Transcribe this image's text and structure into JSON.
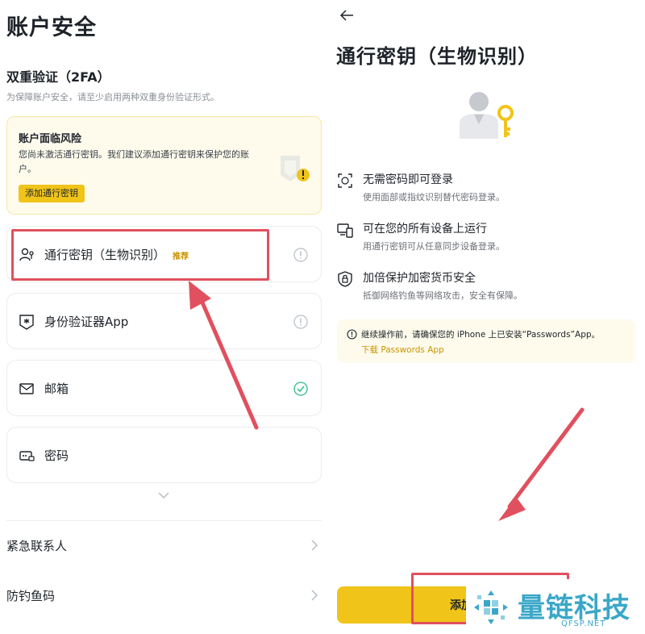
{
  "left": {
    "title": "账户安全",
    "twofa_title": "双重验证（2FA）",
    "twofa_sub": "为保障账户安全，请至少启用两种双重身份验证形式。",
    "risk": {
      "title": "账户面临风险",
      "text": "您尚未激活通行密钥。我们建议添加通行密钥来保护您的账户。",
      "button": "添加通行密钥"
    },
    "methods": [
      {
        "label": "通行密钥（生物识别）",
        "badge": "推荐",
        "icon": "passkey-icon",
        "status": "info"
      },
      {
        "label": "身份验证器App",
        "icon": "authenticator-icon",
        "status": "info"
      },
      {
        "label": "邮箱",
        "icon": "mail-icon",
        "status": "done"
      },
      {
        "label": "密码",
        "icon": "password-icon",
        "status": ""
      }
    ],
    "links": [
      {
        "label": "紧急联系人"
      },
      {
        "label": "防钓鱼码"
      }
    ]
  },
  "right": {
    "title": "通行密钥（生物识别）",
    "features": [
      {
        "title": "无需密码即可登录",
        "sub": "使用面部或指纹识别替代密码登录。",
        "icon": "face-scan-icon"
      },
      {
        "title": "可在您的所有设备上运行",
        "sub": "用通行密钥可从任意同步设备登录。",
        "icon": "devices-icon"
      },
      {
        "title": "加倍保护加密货币安全",
        "sub": "抵御网络钓鱼等网络攻击，安全有保障。",
        "icon": "shield-lock-icon"
      }
    ],
    "notice": {
      "text": "继续操作前，请确保您的 iPhone 上已安装“Passwords”App。",
      "link": "下载 Passwords App"
    },
    "add_button": "添加"
  },
  "watermark": {
    "name": "量链科技",
    "url": "QFSP.NET"
  },
  "colors": {
    "accent": "#f0c419",
    "highlight": "#e0505e",
    "success": "#2ebd85",
    "watermark": "#3aa7c8"
  }
}
